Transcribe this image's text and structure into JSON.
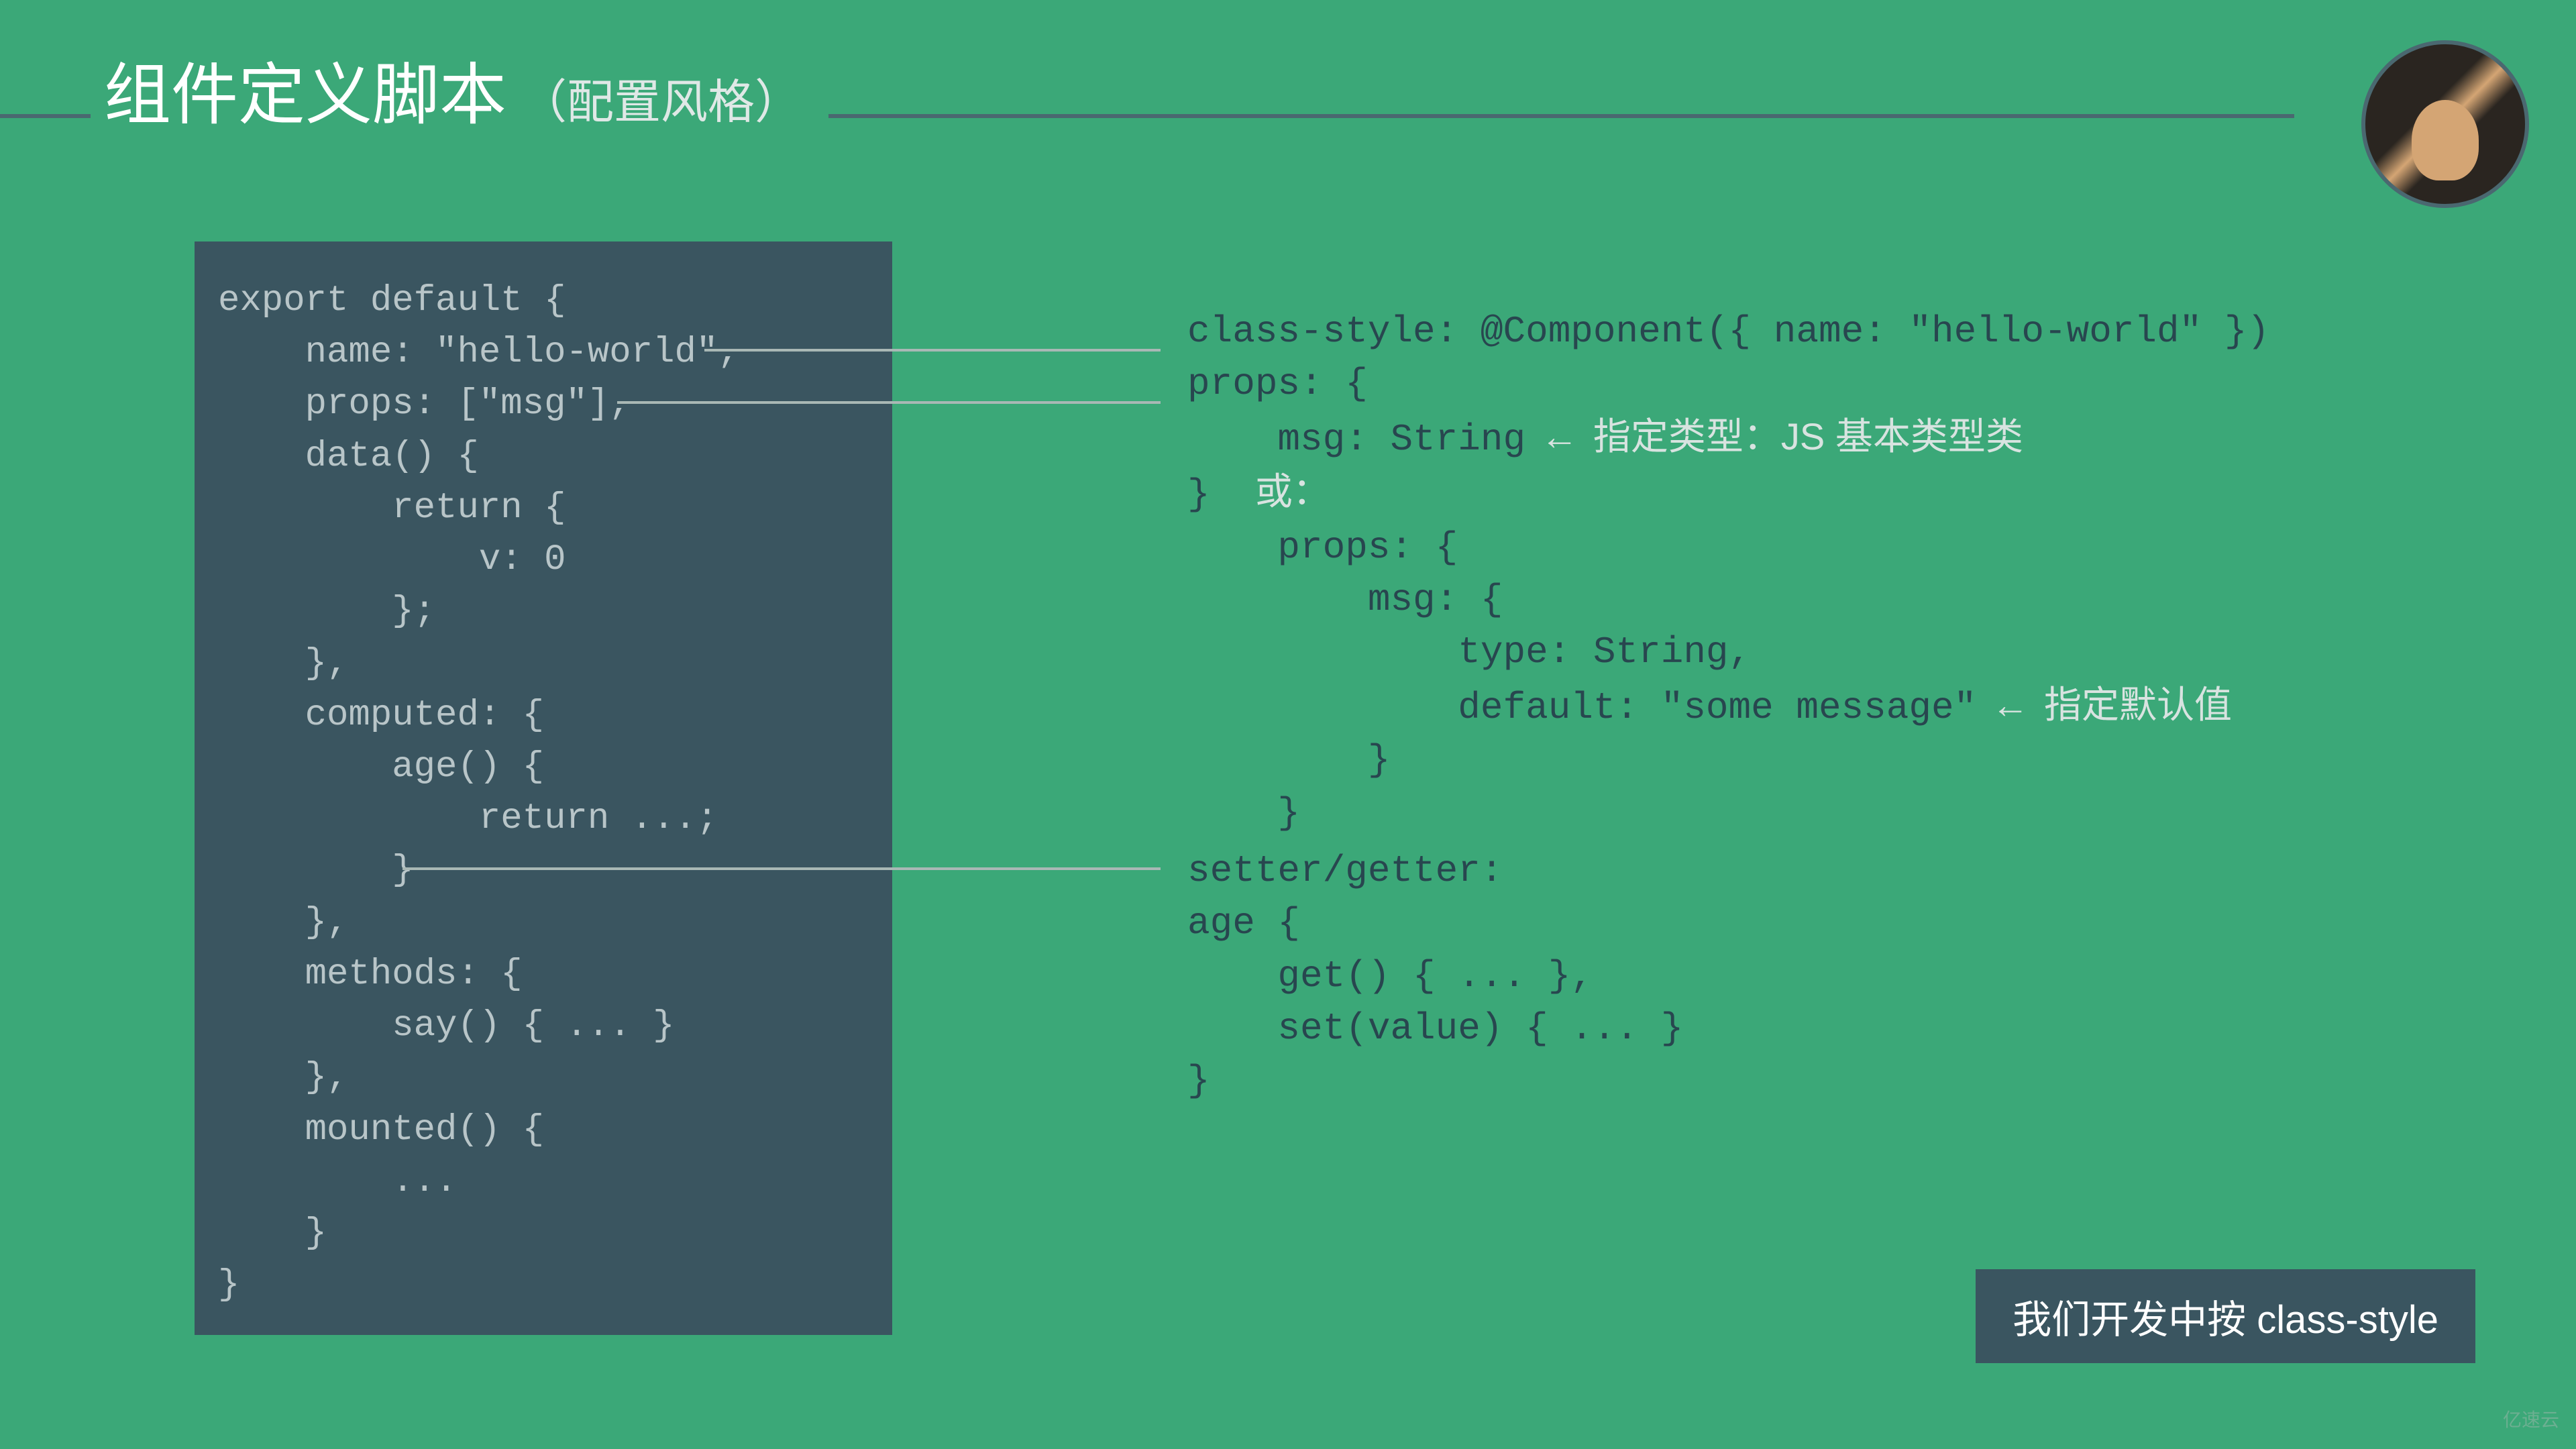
{
  "title": {
    "main": "组件定义脚本",
    "sub": "（配置风格）"
  },
  "leftCode": {
    "l1": "export default {",
    "l2": "    name: \"hello-world\",",
    "l3": "    props: [\"msg\"],",
    "l4": "    data() {",
    "l5": "        return {",
    "l6": "            v: 0",
    "l7": "        };",
    "l8": "    },",
    "l9": "    computed: {",
    "l10": "        age() {",
    "l11": "            return ...;",
    "l12": "        }",
    "l13": "    },",
    "l14": "    methods: {",
    "l15": "        say() { ... }",
    "l16": "    },",
    "l17": "    mounted() {",
    "l18": "        ...",
    "l19": "    }",
    "l20": "}"
  },
  "rightCode": {
    "r1a": "class-style: ",
    "r1b": "@Component({ name: \"hello-world\" })",
    "r2": "props: {",
    "r3a": "    msg: String ",
    "r3arrow": "← ",
    "r3note": "指定类型：JS 基本类型类",
    "r4a": "}  ",
    "r4note": "或：",
    "r5": "    props: {",
    "r6": "        msg: {",
    "r7": "            type: String,",
    "r8a": "            default: \"some message\" ",
    "r8arrow": "← ",
    "r8note": "指定默认值",
    "r9": "        }",
    "r10": "    }",
    "r11": "setter/getter:",
    "r12": "age {",
    "r13": "    get() { ... },",
    "r14": "    set(value) { ... }",
    "r15": "}"
  },
  "footer": {
    "badge": "我们开发中按 class-style"
  },
  "watermark": "亿速云"
}
